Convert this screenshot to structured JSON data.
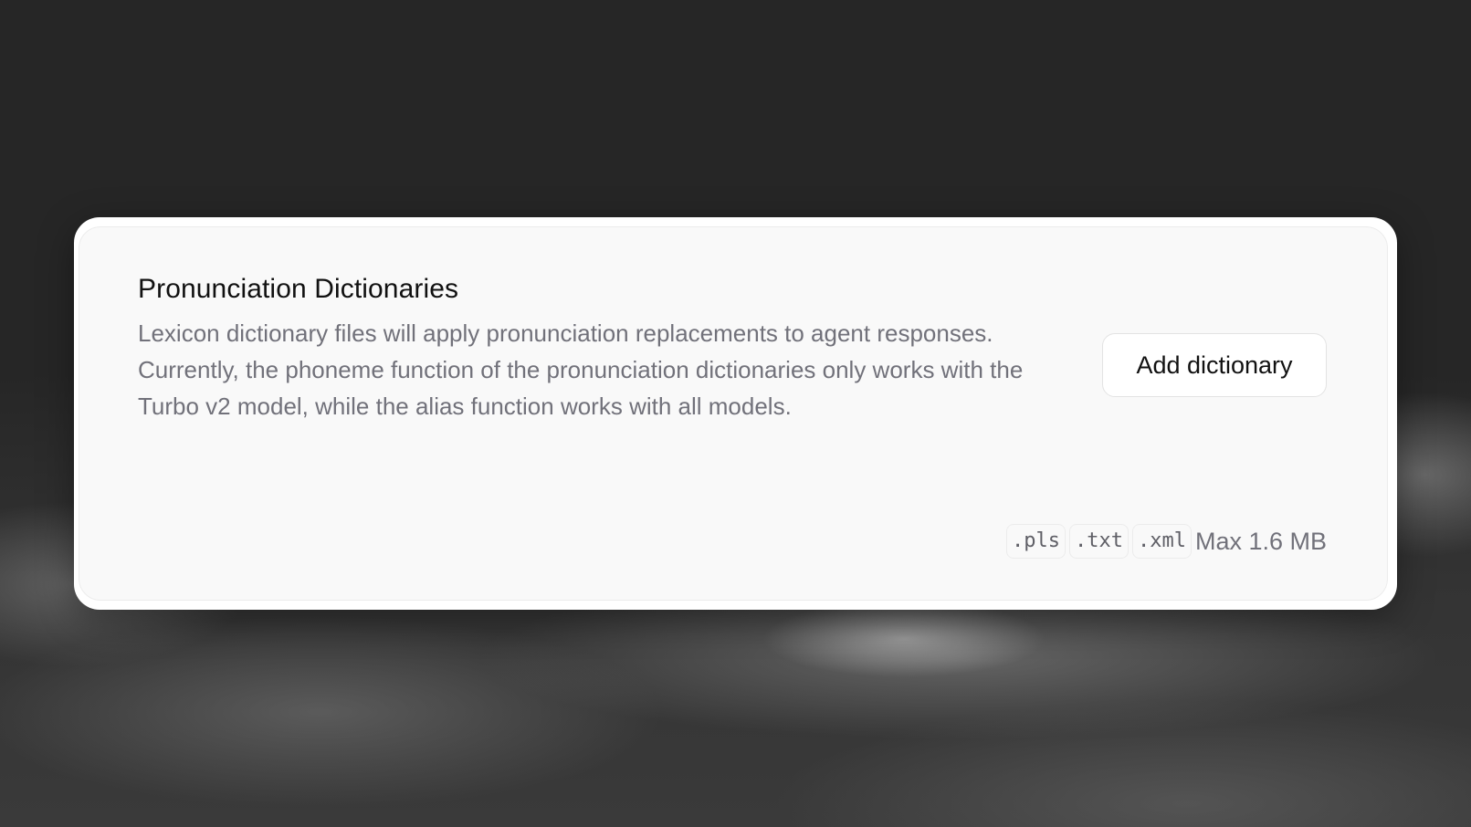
{
  "card": {
    "title": "Pronunciation Dictionaries",
    "description": "Lexicon dictionary files will apply pronunciation replacements to agent responses. Currently, the phoneme function of the pronunciation dictionaries only works with the Turbo v2 model, while the alias function works with all models.",
    "add_button_label": "Add dictionary",
    "file_types": [
      ".pls",
      ".txt",
      ".xml"
    ],
    "max_size": "Max 1.6 MB"
  },
  "colors": {
    "background": "#262626",
    "card": "#ffffff",
    "inner_card": "#f9f9f9",
    "title_text": "#111111",
    "muted_text": "#71717a"
  }
}
